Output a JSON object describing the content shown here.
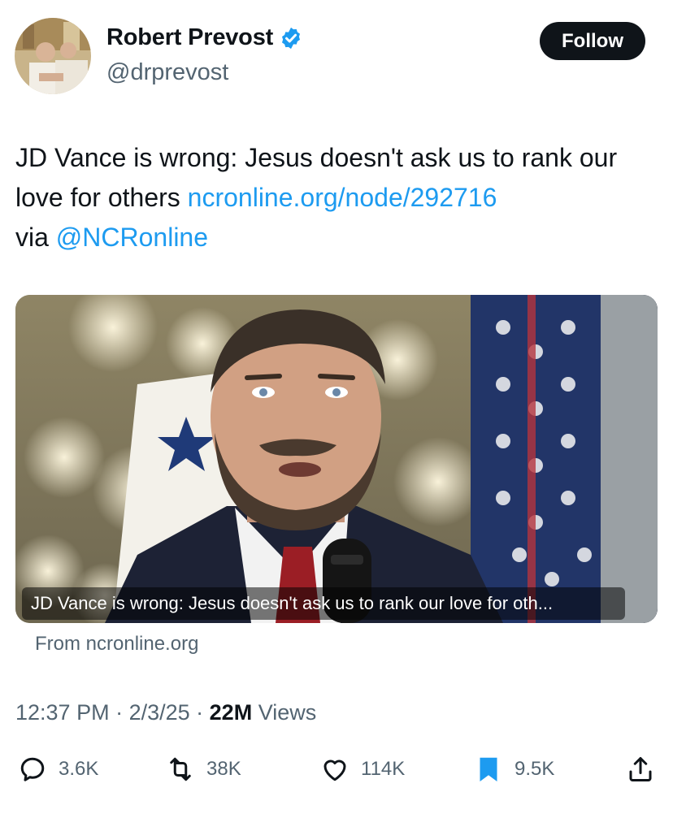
{
  "author": {
    "name": "Robert Prevost",
    "handle": "@drprevost",
    "verified": true
  },
  "follow_label": "Follow",
  "tweet": {
    "text_plain": "JD Vance is wrong: Jesus doesn't ask us to rank our love for others",
    "link": "ncronline.org/node/292716",
    "via_word": "via",
    "mention": "@NCRonline"
  },
  "card": {
    "title": "JD Vance is wrong: Jesus doesn't ask us to rank our love for oth...",
    "source": "From ncronline.org",
    "image_icon": "man-speaking-photo"
  },
  "meta": {
    "time": "12:37 PM",
    "date": "2/3/25",
    "views_count": "22M",
    "views_label": "Views"
  },
  "actions": {
    "replies": "3.6K",
    "reposts": "38K",
    "likes": "114K",
    "bookmarks": "9.5K"
  },
  "colors": {
    "link": "#1d9bf0",
    "text": "#0f1419",
    "secondary": "#536471",
    "bookmark_active": "#1d9bf0"
  }
}
